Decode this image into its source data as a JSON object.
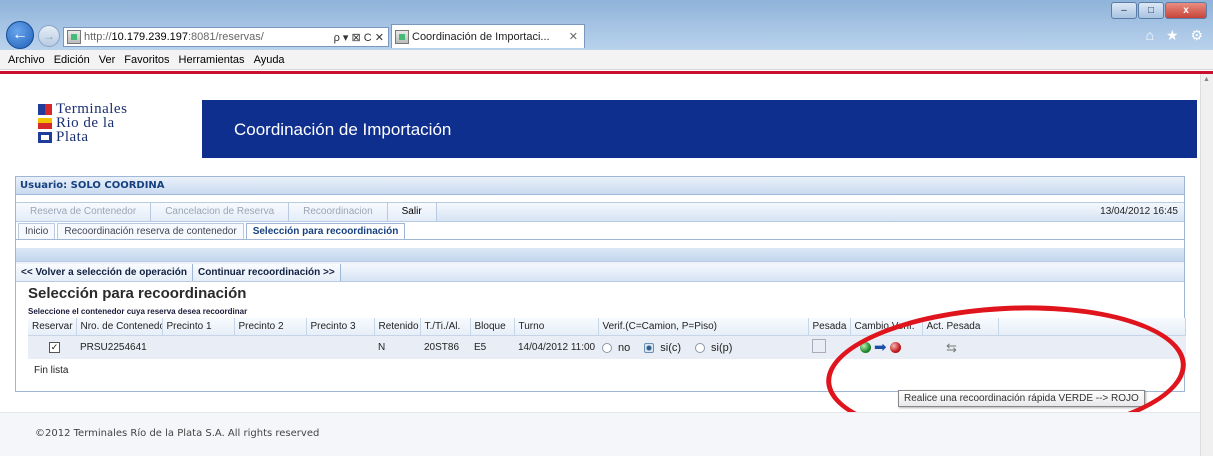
{
  "browser": {
    "url_prefix": "http://",
    "url_host": "10.179.239.197",
    "url_rest": ":8081/reservas/",
    "address_tools": "ρ ▾ ⊠ C ✕",
    "tab_title": "Coordinación de Importaci...",
    "tab_close": "✕",
    "right_icons": "⌂ ★ ⚙",
    "win_min": "‒",
    "win_max": "□",
    "win_close": "x",
    "back": "←",
    "forward": "→",
    "menu": [
      "Archivo",
      "Edición",
      "Ver",
      "Favoritos",
      "Herramientas",
      "Ayuda"
    ]
  },
  "logo": {
    "line1": "Terminales",
    "line2": "Rio de la",
    "line3": "Plata"
  },
  "banner": {
    "title": "Coordinación de Importación"
  },
  "user": {
    "label": "Usuario: SOLO COORDINA"
  },
  "toolbar": {
    "buttons": [
      "Reserva de Contenedor",
      "Cancelacion de Reserva",
      "Recoordinacion",
      "Salir"
    ],
    "datetime": "13/04/2012 16:45"
  },
  "tabs": [
    "Inicio",
    "Recoordinación reserva de contenedor",
    "Selección para recoordinación"
  ],
  "actions": {
    "back": "<< Volver a selección de operación",
    "continue": "Continuar recoordinación >>"
  },
  "section": {
    "title": "Selección para recoordinación",
    "hint": "Seleccione el contenedor cuya reserva desea recoordinar"
  },
  "table": {
    "headers": [
      "Reservar",
      "Nro. de Contenedor",
      "Precinto 1",
      "Precinto 2",
      "Precinto 3",
      "Retenido",
      "T./Ti./Al.",
      "Bloque",
      "Turno",
      "Verif.(C=Camion, P=Piso)",
      "Pesada",
      "Cambio Verif.",
      "Act. Pesada"
    ],
    "row": {
      "checked": "✓",
      "container": "PRSU2254641",
      "precinto1": "",
      "precinto2": "",
      "precinto3": "",
      "retenido": "N",
      "tipo": "20ST86",
      "bloque": "E5",
      "turno": "14/04/2012 11:00",
      "verif_options": [
        "no",
        "si(c)",
        "si(p)"
      ],
      "verif_selected": "si(c)",
      "arrow": "➡",
      "swap": "⇆"
    },
    "end": "Fin lista"
  },
  "tooltip": "Realice una recoordinación rápida VERDE --> ROJO",
  "footer": "©2012 Terminales Río de la Plata S.A. All rights reserved"
}
